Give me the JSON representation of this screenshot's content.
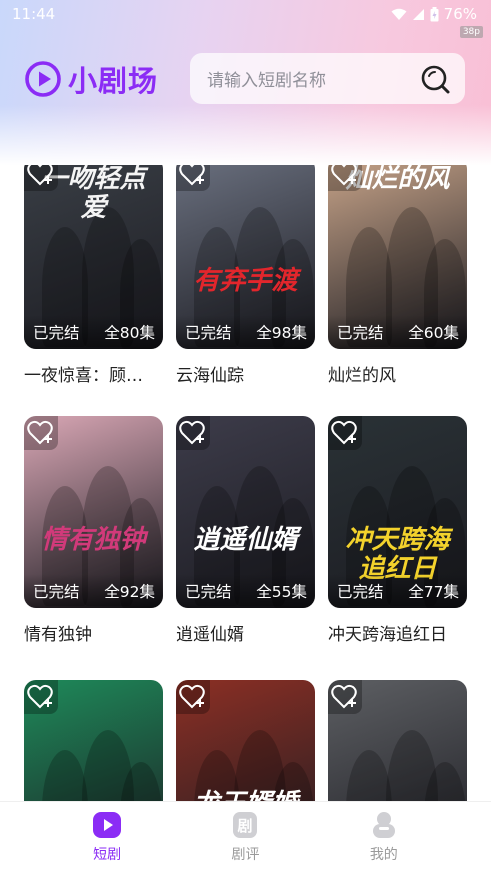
{
  "status_bar": {
    "time": "11:44",
    "battery": "76%",
    "fps_badge": "38p"
  },
  "header": {
    "app_name": "小剧场",
    "search_placeholder": "请输入短剧名称",
    "accent_color": "#8b2cf5"
  },
  "dramas": [
    {
      "title": "一夜惊喜：顾…",
      "status": "已完结",
      "episodes": "全80集",
      "poster_text": "一吻轻点爱",
      "bg": "#3a3f46",
      "art": "#f5f5f5"
    },
    {
      "title": "云海仙踪",
      "status": "已完结",
      "episodes": "全98集",
      "poster_text": "有弃手渡",
      "bg": "#6b7180",
      "art": "#e2262c"
    },
    {
      "title": "灿烂的风",
      "status": "已完结",
      "episodes": "全60集",
      "poster_text": "灿烂的风",
      "bg": "#c9a58a",
      "art": "#ffffff"
    },
    {
      "title": "情有独钟",
      "status": "已完结",
      "episodes": "全92集",
      "poster_text": "情有独钟",
      "bg": "#d9a7b5",
      "art": "#d13a7a"
    },
    {
      "title": "逍遥仙婿",
      "status": "已完结",
      "episodes": "全55集",
      "poster_text": "逍遥仙婿",
      "bg": "#3d3c4a",
      "art": "#ffffff"
    },
    {
      "title": "冲天跨海追红日",
      "status": "已完结",
      "episodes": "全77集",
      "poster_text": "冲天跨海追红日",
      "bg": "#2a3236",
      "art": "#f3d22c"
    },
    {
      "title": "",
      "status": "",
      "episodes": "",
      "poster_text": "",
      "bg": "#1e8a5a",
      "art": "#ffd400"
    },
    {
      "title": "",
      "status": "",
      "episodes": "",
      "poster_text": "龙王婿婚",
      "bg": "#8c2f24",
      "art": "#ffffff"
    },
    {
      "title": "",
      "status": "",
      "episodes": "",
      "poster_text": "",
      "bg": "#5d5f63",
      "art": "#ffffff"
    }
  ],
  "tabs": [
    {
      "label": "短剧",
      "icon": "play-icon",
      "active": true
    },
    {
      "label": "剧评",
      "icon": "review-icon",
      "active": false
    },
    {
      "label": "我的",
      "icon": "profile-icon",
      "active": false
    }
  ]
}
